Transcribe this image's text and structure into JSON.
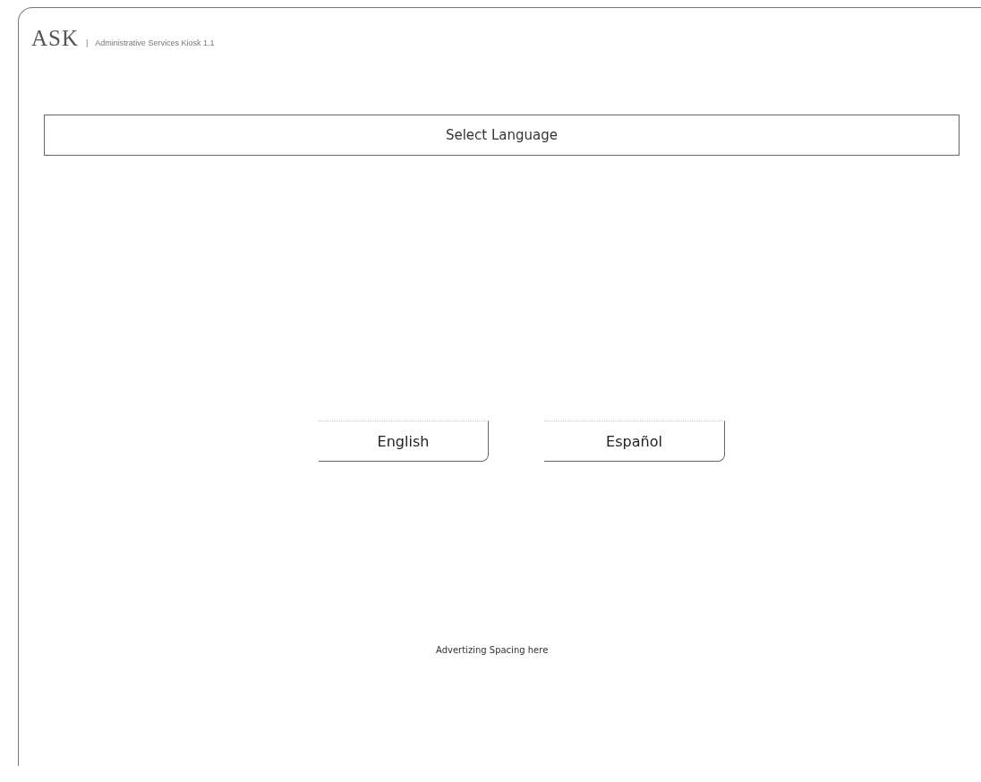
{
  "header": {
    "logo": "ASK",
    "separator": "|",
    "subtitle": "Administrative Services Kiosk 1.1"
  },
  "title_bar": "Select Language",
  "language_buttons": [
    {
      "label": "English"
    },
    {
      "label": "Español"
    }
  ],
  "footer_note": "Advertizing Spacing here"
}
